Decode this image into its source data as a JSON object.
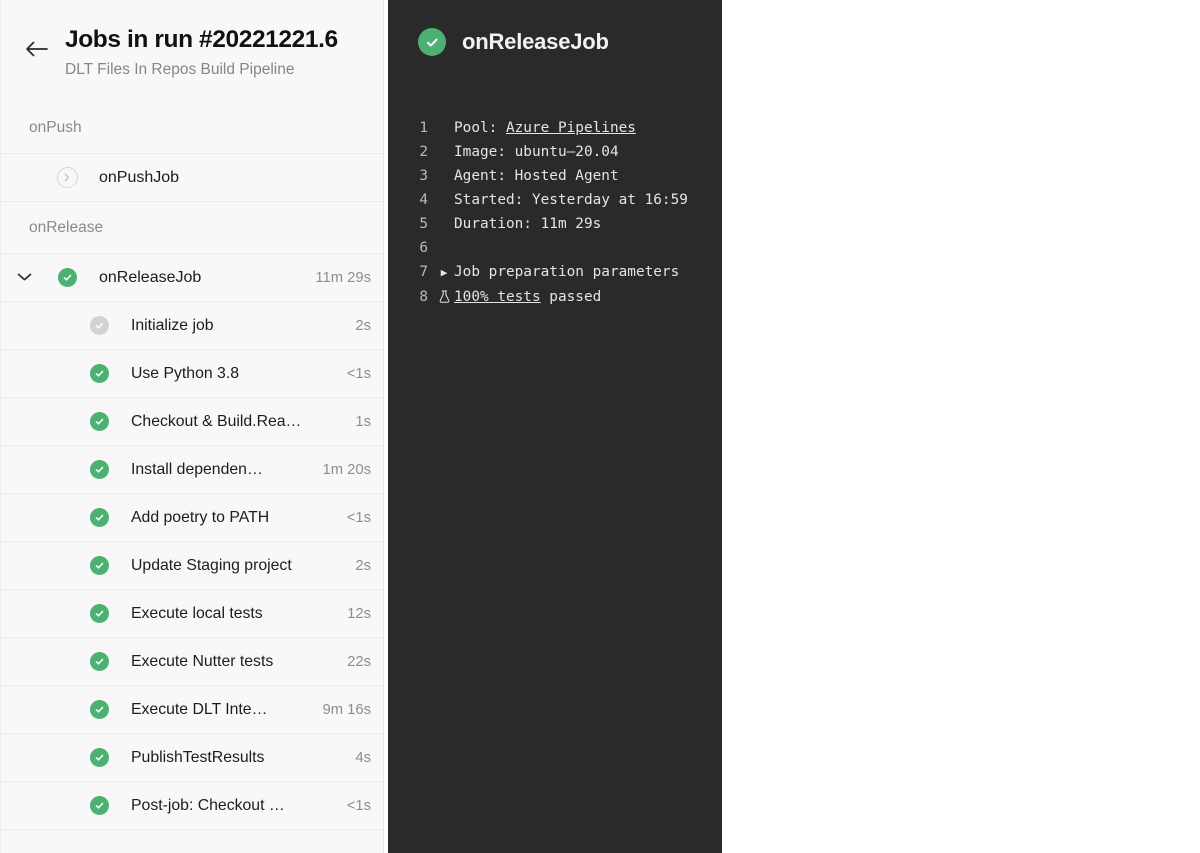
{
  "sidebar": {
    "back_icon": "arrow-left-icon",
    "run_title": "Jobs in run #20221221.6",
    "pipeline_name": "DLT Files In Repos Build Pipeline",
    "sections": [
      {
        "name": "onPush",
        "rows": [
          {
            "label": "onPushJob",
            "duration": "",
            "status": "collapsed",
            "kind": "job",
            "expander": "circle-chevron-right-icon"
          }
        ]
      },
      {
        "name": "onRelease",
        "rows": [
          {
            "label": "onReleaseJob",
            "duration": "11m 29s",
            "status": "success",
            "kind": "job",
            "expander": "chevron-down-icon"
          },
          {
            "label": "Initialize job",
            "duration": "2s",
            "status": "skipped",
            "kind": "task",
            "expander": ""
          },
          {
            "label": "Use Python 3.8",
            "duration": "<1s",
            "status": "success",
            "kind": "task",
            "expander": ""
          },
          {
            "label": "Checkout & Build.Rea…",
            "duration": "1s",
            "status": "success",
            "kind": "task",
            "expander": ""
          },
          {
            "label": "Install dependen…",
            "duration": "1m 20s",
            "status": "success",
            "kind": "task",
            "expander": ""
          },
          {
            "label": "Add poetry to PATH",
            "duration": "<1s",
            "status": "success",
            "kind": "task",
            "expander": ""
          },
          {
            "label": "Update Staging project",
            "duration": "2s",
            "status": "success",
            "kind": "task",
            "expander": ""
          },
          {
            "label": "Execute local tests",
            "duration": "12s",
            "status": "success",
            "kind": "task",
            "expander": ""
          },
          {
            "label": "Execute Nutter tests",
            "duration": "22s",
            "status": "success",
            "kind": "task",
            "expander": ""
          },
          {
            "label": "Execute DLT Inte…",
            "duration": "9m 16s",
            "status": "success",
            "kind": "task",
            "expander": ""
          },
          {
            "label": "PublishTestResults",
            "duration": "4s",
            "status": "success",
            "kind": "task",
            "expander": ""
          },
          {
            "label": "Post-job: Checkout …",
            "duration": "<1s",
            "status": "success",
            "kind": "task",
            "expander": ""
          }
        ]
      }
    ]
  },
  "log": {
    "status_icon": "check-circle-icon",
    "title": "onReleaseJob",
    "lines": [
      {
        "n": "1",
        "mark": "",
        "text": "Pool: ",
        "link": "Azure Pipelines",
        "tail": ""
      },
      {
        "n": "2",
        "mark": "",
        "text": "Image: ubuntu‒20.04",
        "link": "",
        "tail": ""
      },
      {
        "n": "3",
        "mark": "",
        "text": "Agent: Hosted Agent",
        "link": "",
        "tail": ""
      },
      {
        "n": "4",
        "mark": "",
        "text": "Started: Yesterday at 16:59",
        "link": "",
        "tail": ""
      },
      {
        "n": "5",
        "mark": "",
        "text": "Duration: 11m 29s",
        "link": "",
        "tail": ""
      },
      {
        "n": "6",
        "mark": "",
        "text": "",
        "link": "",
        "tail": ""
      },
      {
        "n": "7",
        "mark": "▶",
        "text": "Job preparation parameters",
        "link": "",
        "tail": ""
      },
      {
        "n": "8",
        "mark": "flask",
        "text": "",
        "link": "100% tests",
        "tail": " passed"
      }
    ]
  },
  "colors": {
    "success_green": "#4cb173",
    "skipped_grey": "#d2d2d2",
    "sidebar_bg": "#f8f8f8",
    "log_bg": "#2a2a2a"
  }
}
